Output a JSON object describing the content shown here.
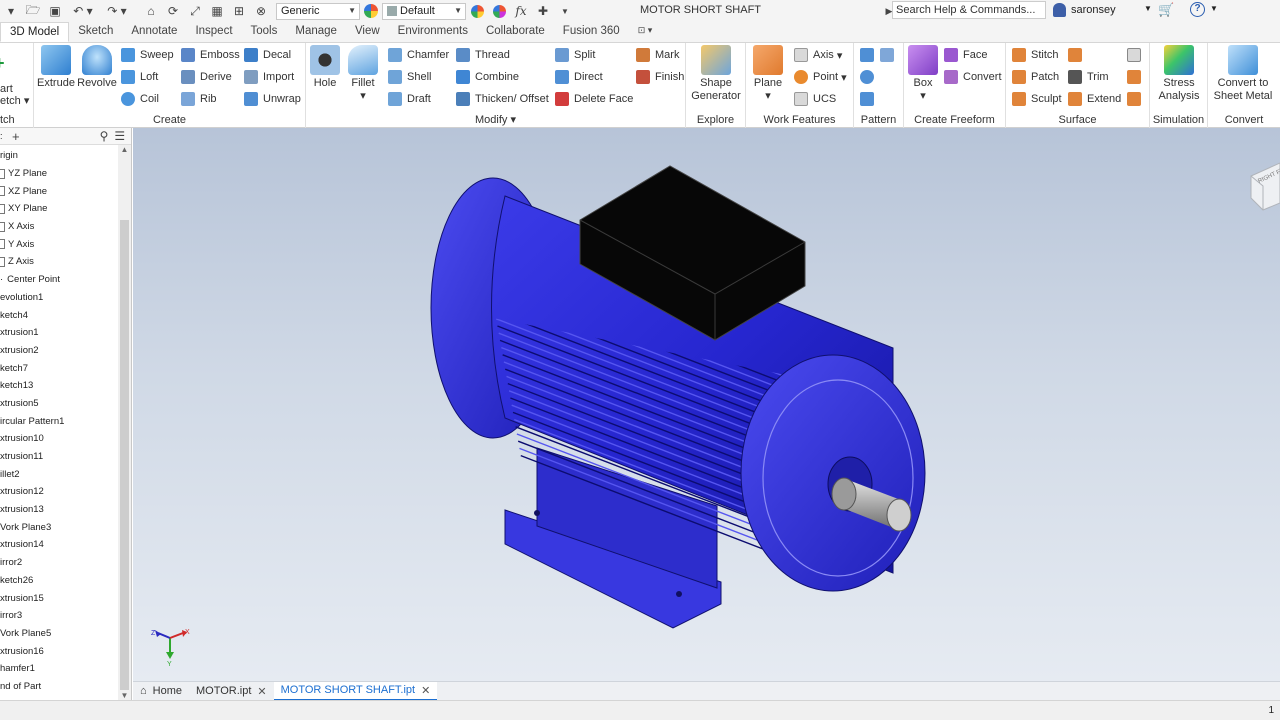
{
  "window": {
    "title": "MOTOR SHORT SHAFT",
    "search_placeholder": "Search Help & Commands...",
    "user": "saronsey"
  },
  "qat": {
    "material": "Generic",
    "appearance": "Default",
    "fx": "fx"
  },
  "tabs": [
    "3D Model",
    "Sketch",
    "Annotate",
    "Inspect",
    "Tools",
    "Manage",
    "View",
    "Environments",
    "Collaborate",
    "Fusion 360"
  ],
  "ribbon": {
    "sketch": {
      "start_label": "art",
      "start_label2": "etch",
      "panel": "tch"
    },
    "create": {
      "panel": "Create",
      "extrude": "Extrude",
      "revolve": "Revolve",
      "sweep": "Sweep",
      "loft": "Loft",
      "coil": "Coil",
      "emboss": "Emboss",
      "derive": "Derive",
      "rib": "Rib",
      "decal": "Decal",
      "import": "Import",
      "unwrap": "Unwrap"
    },
    "modify": {
      "panel": "Modify",
      "hole": "Hole",
      "fillet": "Fillet",
      "chamfer": "Chamfer",
      "shell": "Shell",
      "draft": "Draft",
      "thread": "Thread",
      "combine": "Combine",
      "thicken": "Thicken/ Offset",
      "split": "Split",
      "direct": "Direct",
      "delete_face": "Delete Face",
      "mark": "Mark",
      "finish": "Finish"
    },
    "explore": {
      "panel": "Explore",
      "shape_gen": "Shape Generator"
    },
    "work": {
      "panel": "Work Features",
      "plane": "Plane",
      "axis": "Axis",
      "point": "Point",
      "ucs": "UCS"
    },
    "pattern": {
      "panel": "Pattern"
    },
    "freeform": {
      "panel": "Create Freeform",
      "box": "Box",
      "face": "Face",
      "convert": "Convert"
    },
    "surface": {
      "panel": "Surface",
      "stitch": "Stitch",
      "patch": "Patch",
      "sculpt": "Sculpt",
      "trim": "Trim",
      "extend": "Extend"
    },
    "simulation": {
      "panel": "Simulation",
      "stress": "Stress Analysis"
    },
    "convert": {
      "panel": "Convert",
      "sheet_metal": "Convert to Sheet Metal"
    }
  },
  "browser": {
    "nodes": [
      "rigin",
      "YZ Plane",
      "XZ Plane",
      "XY Plane",
      "X Axis",
      "Y Axis",
      "Z Axis",
      "Center Point",
      "evolution1",
      "ketch4",
      "xtrusion1",
      "xtrusion2",
      "ketch7",
      "ketch13",
      "xtrusion5",
      "ircular Pattern1",
      "xtrusion10",
      "xtrusion11",
      "illet2",
      "xtrusion12",
      "xtrusion13",
      "Vork Plane3",
      "xtrusion14",
      "irror2",
      "ketch26",
      "xtrusion15",
      "irror3",
      "Vork Plane5",
      "xtrusion16",
      "hamfer1",
      "nd of Part"
    ]
  },
  "viewport": {
    "viewcube_text": "RIGHT FRONT",
    "triad": {
      "x": "X",
      "y": "Y",
      "z": "Z"
    }
  },
  "doc_tabs": {
    "home": "Home",
    "motor": "MOTOR.ipt",
    "active": "MOTOR SHORT SHAFT.ipt"
  },
  "status": {
    "page": "1"
  },
  "colors": {
    "accent": "#1c6fd1",
    "motor_body": "#2a2ad8",
    "terminal_box": "#050505",
    "shaft": "#a8a8a8"
  }
}
